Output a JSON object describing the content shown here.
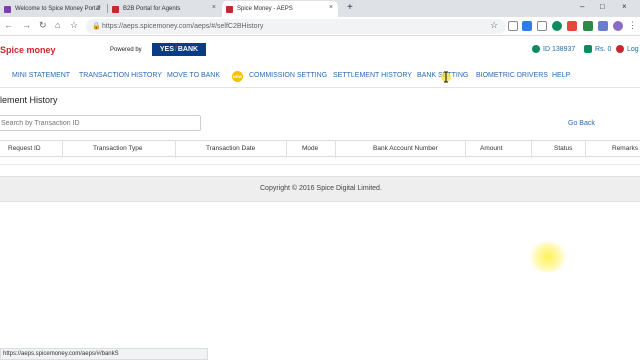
{
  "browser": {
    "tabs": [
      {
        "title": "Welcome to Spice Money Portal",
        "close": "×",
        "favicon_color": "#7b3fb3"
      },
      {
        "title": "B2B Portal for Agents",
        "close": "×",
        "favicon_color": "#c8282d"
      },
      {
        "title": "Spice Money - AEPS",
        "close": "×",
        "favicon_color": "#c8282d"
      }
    ],
    "new_tab": "+",
    "url": "https://aeps.spicemoney.com/aeps/#/selfC2BHistory",
    "status_url": "https://aeps.spicemoney.com/aeps/#/bankS",
    "window_controls": [
      "–",
      "□",
      "×"
    ],
    "icons": [
      "back-icon",
      "forward-icon",
      "reload-icon",
      "star-icon",
      "lock-icon"
    ]
  },
  "header": {
    "logo_text": "Spice money",
    "powered_by": "Powered by",
    "bank_left": "YES",
    "bank_right": "BANK",
    "agent_id": "ID 138937",
    "balance": "Rs. 0",
    "logout": "Log"
  },
  "menu": {
    "items": [
      "MINI STATEMENT",
      "TRANSACTION HISTORY",
      "MOVE TO BANK",
      "COMMISSION SETTING",
      "SETTLEMENT HISTORY",
      "BANK SETTING",
      "BIOMETRIC DRIVERS",
      "HELP"
    ],
    "badge_text": "NEW"
  },
  "page": {
    "title": "lement History",
    "search_placeholder": "Search by Transaction ID",
    "go_back": "Go Back"
  },
  "table": {
    "columns": [
      "Request ID",
      "Transaction Type",
      "Transaction Date",
      "Mode",
      "Bank Account Number",
      "Amount",
      "Status",
      "Remarks"
    ],
    "rows": []
  },
  "footer": {
    "copyright": "Copyright © 2016 Spice Digital Limited."
  },
  "colors": {
    "brand_red": "#c8282d",
    "menu_blue": "#2a6ab4",
    "bank_navy": "#0a3b86",
    "badge_yellow": "#f6c200"
  }
}
